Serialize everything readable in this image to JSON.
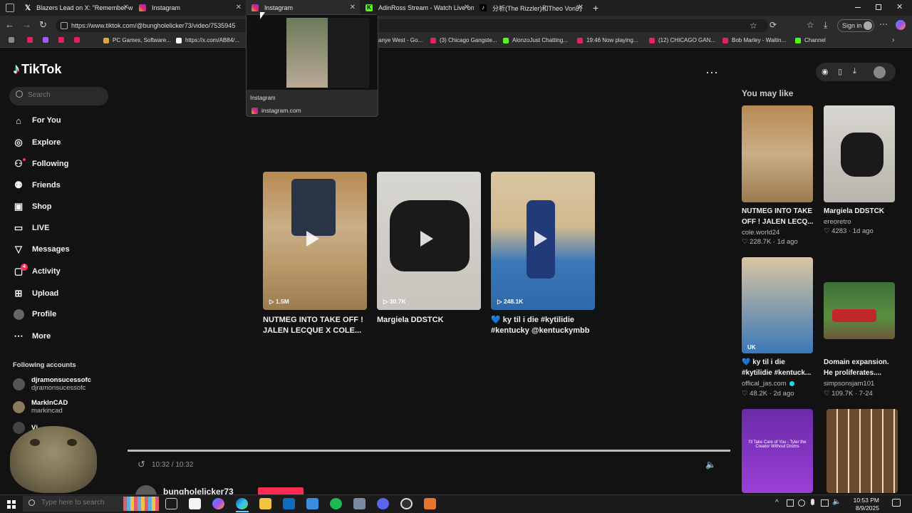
{
  "browser": {
    "tabs": [
      {
        "label": "Blazers Lead on X: \"Remember w",
        "icon": "x-logo-icon",
        "color": "#ffffff"
      },
      {
        "label": "Instagram",
        "icon": "instagram-icon",
        "color": "#d62976"
      },
      {
        "label": "Instagram",
        "icon": "instagram-icon",
        "color": "#d62976"
      },
      {
        "label": "AdinRoss Stream - Watch Live on",
        "icon": "kick-icon",
        "color": "#53fc18"
      },
      {
        "label": "分析(The Rizzler)和Theo Von的",
        "icon": "tiktok-icon",
        "color": "#ffffff"
      }
    ],
    "url": "https://www.tiktok.com/@bungholelicker73/video/7535945",
    "bookmarks": [
      {
        "label": "",
        "color": "#e0245e"
      },
      {
        "label": "",
        "color": "#a259ff"
      },
      {
        "label": "",
        "color": "#e0245e"
      },
      {
        "label": "",
        "color": "#e0245e"
      },
      {
        "label": "PC Games, Software...",
        "color": "#d9a441"
      },
      {
        "label": "https://x.com/AB84/...",
        "color": "#ffffff"
      },
      {
        "label": "anye West - Go...",
        "color": "#e0245e"
      },
      {
        "label": "(3) Chicago Gangste...",
        "color": "#e0245e"
      },
      {
        "label": "AlonzoJust Chatting...",
        "color": "#53fc18"
      },
      {
        "label": "19:46 Now playing...",
        "color": "#e0245e"
      },
      {
        "label": "(12) CHICAGO GAN...",
        "color": "#e0245e"
      },
      {
        "label": "Bob Marley - Waitin...",
        "color": "#e0245e"
      },
      {
        "label": "Channel",
        "color": "#53fc18"
      }
    ],
    "sign_in": "Sign in",
    "new_tab": "+"
  },
  "popup": {
    "title": "Instagram",
    "domain": "instagram.com"
  },
  "tiktok": {
    "logo": "TikTok",
    "search_placeholder": "Search",
    "nav": [
      {
        "label": "For You",
        "icon": "home-icon"
      },
      {
        "label": "Explore",
        "icon": "compass-icon"
      },
      {
        "label": "Following",
        "icon": "following-icon"
      },
      {
        "label": "Friends",
        "icon": "friends-icon"
      },
      {
        "label": "Shop",
        "icon": "shop-icon"
      },
      {
        "label": "LIVE",
        "icon": "live-icon"
      },
      {
        "label": "Messages",
        "icon": "messages-icon"
      },
      {
        "label": "Activity",
        "icon": "activity-icon",
        "badge": "4"
      },
      {
        "label": "Upload",
        "icon": "upload-icon"
      },
      {
        "label": "Profile",
        "icon": "profile-icon"
      },
      {
        "label": "More",
        "icon": "more-icon"
      }
    ],
    "following_header": "Following accounts",
    "accounts": [
      {
        "name": "djramonsucessofc",
        "handle": "djramonsucessofc"
      },
      {
        "name": "MarkInCAD",
        "handle": "markincad"
      },
      {
        "name": "Vj",
        "handle": ""
      }
    ],
    "videos": [
      {
        "views": "1.5M",
        "title": "NUTMEG INTO TAKE OFF ! JALEN LECQUE X COLE..."
      },
      {
        "views": "30.7K",
        "title": "Margiela DDSTCK"
      },
      {
        "views": "248.1K",
        "title": "💙 ky til i die #kytilidie #kentucky @kentuckymbb"
      }
    ],
    "player": {
      "time": "10:32 / 10:32",
      "progress": 1.0,
      "author": "bungholelicker73"
    },
    "you_may_like": "You may like",
    "suggested": [
      {
        "title": "NUTMEG INTO TAKE OFF ! JALEN LECQ...",
        "author": "cole.world24",
        "likes": "228.7K",
        "age": "1d ago"
      },
      {
        "title": "Margiela DDSTCK",
        "author": "ereoretro",
        "likes": "4283",
        "age": "1d ago"
      },
      {
        "title": "💙 ky til i die #kytilidie #kentuck...",
        "author": "offical_jas.com",
        "likes": "48.2K",
        "age": "2d ago"
      },
      {
        "title": "Domain expansion. He proliferates....",
        "author": "simpsonsjam101",
        "likes": "109.7K",
        "age": "7-24"
      }
    ],
    "thumb_text": "I'll Take Care of You - Tyler the Creator Without Drums"
  },
  "taskbar": {
    "search_placeholder": "Type here to search",
    "time": "10:53 PM",
    "date": "8/9/2025"
  }
}
